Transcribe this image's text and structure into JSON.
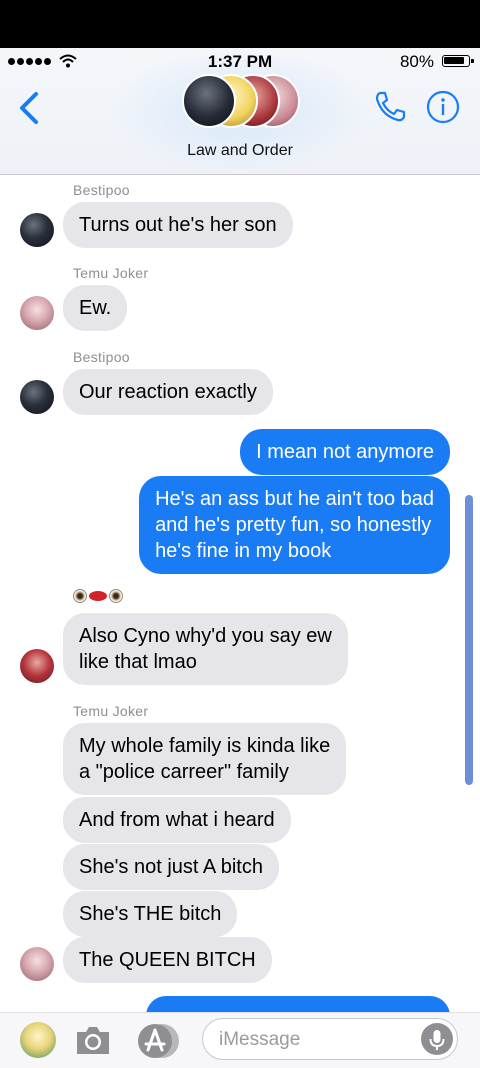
{
  "status_bar": {
    "time": "1:37 PM",
    "battery": "80%",
    "battery_level": 0.8
  },
  "header": {
    "title": "Law and Order"
  },
  "messages": {
    "sender_bestipoo_1": "Bestipoo",
    "m1": "Turns out he's her son",
    "sender_temu_1": "Temu Joker",
    "m2": "Ew.",
    "sender_bestipoo_2": "Bestipoo",
    "m3": "Our reaction exactly",
    "m4": "I mean not anymore",
    "m5": "He's an ass but he ain't too bad\nand he's pretty fun, so honestly\nhe's fine in my book",
    "m6": "Also Cyno why'd you say ew\nlike that lmao",
    "sender_temu_2": "Temu Joker",
    "m7": "My whole family is kinda like\na \"police carreer\" family",
    "m8": "And from what i heard",
    "m9": "She's not just A bitch",
    "m10": "She's THE bitch",
    "m11": "The QUEEN BITCH"
  },
  "composer": {
    "placeholder": "iMessage"
  },
  "icons": [
    "back-chevron-icon",
    "phone-icon",
    "info-icon",
    "camera-icon",
    "app-store-icon",
    "mic-icon"
  ],
  "colors": {
    "accent": "#1a7cf5",
    "incoming_bubble": "#e5e5ea"
  }
}
